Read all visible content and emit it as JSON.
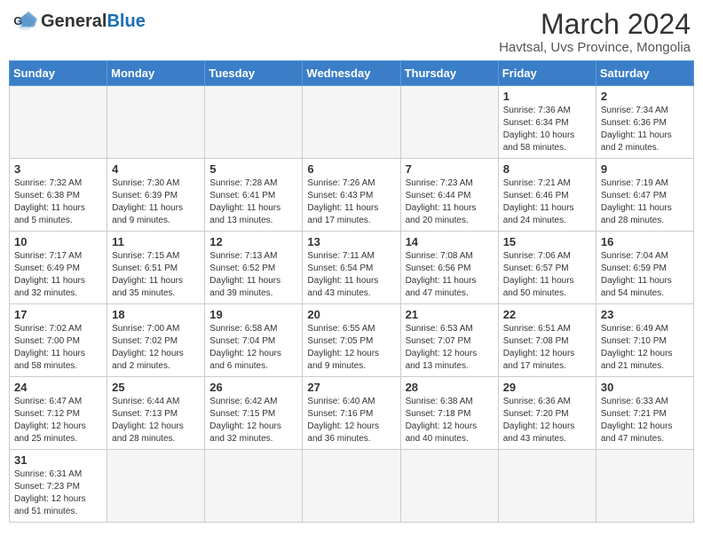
{
  "header": {
    "logo_general": "General",
    "logo_blue": "Blue",
    "month_year": "March 2024",
    "location": "Havtsal, Uvs Province, Mongolia"
  },
  "days_of_week": [
    "Sunday",
    "Monday",
    "Tuesday",
    "Wednesday",
    "Thursday",
    "Friday",
    "Saturday"
  ],
  "weeks": [
    [
      {
        "day": "",
        "info": ""
      },
      {
        "day": "",
        "info": ""
      },
      {
        "day": "",
        "info": ""
      },
      {
        "day": "",
        "info": ""
      },
      {
        "day": "",
        "info": ""
      },
      {
        "day": "1",
        "info": "Sunrise: 7:36 AM\nSunset: 6:34 PM\nDaylight: 10 hours and 58 minutes."
      },
      {
        "day": "2",
        "info": "Sunrise: 7:34 AM\nSunset: 6:36 PM\nDaylight: 11 hours and 2 minutes."
      }
    ],
    [
      {
        "day": "3",
        "info": "Sunrise: 7:32 AM\nSunset: 6:38 PM\nDaylight: 11 hours and 5 minutes."
      },
      {
        "day": "4",
        "info": "Sunrise: 7:30 AM\nSunset: 6:39 PM\nDaylight: 11 hours and 9 minutes."
      },
      {
        "day": "5",
        "info": "Sunrise: 7:28 AM\nSunset: 6:41 PM\nDaylight: 11 hours and 13 minutes."
      },
      {
        "day": "6",
        "info": "Sunrise: 7:26 AM\nSunset: 6:43 PM\nDaylight: 11 hours and 17 minutes."
      },
      {
        "day": "7",
        "info": "Sunrise: 7:23 AM\nSunset: 6:44 PM\nDaylight: 11 hours and 20 minutes."
      },
      {
        "day": "8",
        "info": "Sunrise: 7:21 AM\nSunset: 6:46 PM\nDaylight: 11 hours and 24 minutes."
      },
      {
        "day": "9",
        "info": "Sunrise: 7:19 AM\nSunset: 6:47 PM\nDaylight: 11 hours and 28 minutes."
      }
    ],
    [
      {
        "day": "10",
        "info": "Sunrise: 7:17 AM\nSunset: 6:49 PM\nDaylight: 11 hours and 32 minutes."
      },
      {
        "day": "11",
        "info": "Sunrise: 7:15 AM\nSunset: 6:51 PM\nDaylight: 11 hours and 35 minutes."
      },
      {
        "day": "12",
        "info": "Sunrise: 7:13 AM\nSunset: 6:52 PM\nDaylight: 11 hours and 39 minutes."
      },
      {
        "day": "13",
        "info": "Sunrise: 7:11 AM\nSunset: 6:54 PM\nDaylight: 11 hours and 43 minutes."
      },
      {
        "day": "14",
        "info": "Sunrise: 7:08 AM\nSunset: 6:56 PM\nDaylight: 11 hours and 47 minutes."
      },
      {
        "day": "15",
        "info": "Sunrise: 7:06 AM\nSunset: 6:57 PM\nDaylight: 11 hours and 50 minutes."
      },
      {
        "day": "16",
        "info": "Sunrise: 7:04 AM\nSunset: 6:59 PM\nDaylight: 11 hours and 54 minutes."
      }
    ],
    [
      {
        "day": "17",
        "info": "Sunrise: 7:02 AM\nSunset: 7:00 PM\nDaylight: 11 hours and 58 minutes."
      },
      {
        "day": "18",
        "info": "Sunrise: 7:00 AM\nSunset: 7:02 PM\nDaylight: 12 hours and 2 minutes."
      },
      {
        "day": "19",
        "info": "Sunrise: 6:58 AM\nSunset: 7:04 PM\nDaylight: 12 hours and 6 minutes."
      },
      {
        "day": "20",
        "info": "Sunrise: 6:55 AM\nSunset: 7:05 PM\nDaylight: 12 hours and 9 minutes."
      },
      {
        "day": "21",
        "info": "Sunrise: 6:53 AM\nSunset: 7:07 PM\nDaylight: 12 hours and 13 minutes."
      },
      {
        "day": "22",
        "info": "Sunrise: 6:51 AM\nSunset: 7:08 PM\nDaylight: 12 hours and 17 minutes."
      },
      {
        "day": "23",
        "info": "Sunrise: 6:49 AM\nSunset: 7:10 PM\nDaylight: 12 hours and 21 minutes."
      }
    ],
    [
      {
        "day": "24",
        "info": "Sunrise: 6:47 AM\nSunset: 7:12 PM\nDaylight: 12 hours and 25 minutes."
      },
      {
        "day": "25",
        "info": "Sunrise: 6:44 AM\nSunset: 7:13 PM\nDaylight: 12 hours and 28 minutes."
      },
      {
        "day": "26",
        "info": "Sunrise: 6:42 AM\nSunset: 7:15 PM\nDaylight: 12 hours and 32 minutes."
      },
      {
        "day": "27",
        "info": "Sunrise: 6:40 AM\nSunset: 7:16 PM\nDaylight: 12 hours and 36 minutes."
      },
      {
        "day": "28",
        "info": "Sunrise: 6:38 AM\nSunset: 7:18 PM\nDaylight: 12 hours and 40 minutes."
      },
      {
        "day": "29",
        "info": "Sunrise: 6:36 AM\nSunset: 7:20 PM\nDaylight: 12 hours and 43 minutes."
      },
      {
        "day": "30",
        "info": "Sunrise: 6:33 AM\nSunset: 7:21 PM\nDaylight: 12 hours and 47 minutes."
      }
    ],
    [
      {
        "day": "31",
        "info": "Sunrise: 6:31 AM\nSunset: 7:23 PM\nDaylight: 12 hours and 51 minutes."
      },
      {
        "day": "",
        "info": ""
      },
      {
        "day": "",
        "info": ""
      },
      {
        "day": "",
        "info": ""
      },
      {
        "day": "",
        "info": ""
      },
      {
        "day": "",
        "info": ""
      },
      {
        "day": "",
        "info": ""
      }
    ]
  ]
}
